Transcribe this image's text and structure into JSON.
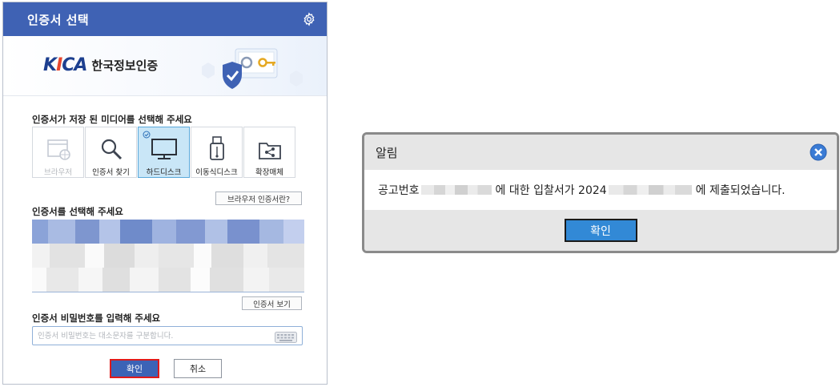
{
  "cert_dialog": {
    "title": "인증서 선택",
    "logo_brand_k": "K",
    "logo_brand_i": "I",
    "logo_brand_ca": "CA",
    "logo_korean": "한국정보인증",
    "media_label": "인증서가 저장 된 미디어를 선택해 주세요",
    "media": [
      {
        "label": "브라우저",
        "icon": "browser-icon",
        "state": "disabled"
      },
      {
        "label": "인증서 찾기",
        "icon": "magnifier-icon",
        "state": "normal"
      },
      {
        "label": "하드디스크",
        "icon": "monitor-icon",
        "state": "selected"
      },
      {
        "label": "이동식디스크",
        "icon": "usb-icon",
        "state": "normal"
      },
      {
        "label": "확장매체",
        "icon": "share-folder-icon",
        "state": "normal"
      }
    ],
    "browser_cert_btn": "브라우저 인증서란?",
    "cert_list_label": "인증서를 선택해 주세요",
    "view_cert_btn": "인증서 보기",
    "password_label": "인증서 비밀번호를 입력해 주세요",
    "password_placeholder": "인증서 비밀번호는 대소문자를 구분합니다.",
    "ok_label": "확인",
    "cancel_label": "취소",
    "colors": {
      "title_bar": "#3f62b4",
      "ok_button": "#3c63b6",
      "ok_highlight": "#e01a1a"
    }
  },
  "alert_dialog": {
    "title": "알림",
    "msg_part1": "공고번호",
    "msg_part2": "에 대한 입찰서가 2024",
    "msg_part3": "에 제출되었습니다.",
    "ok_label": "확인",
    "colors": {
      "ok_button": "#3289d6",
      "close_icon": "#3a7bd5"
    }
  }
}
